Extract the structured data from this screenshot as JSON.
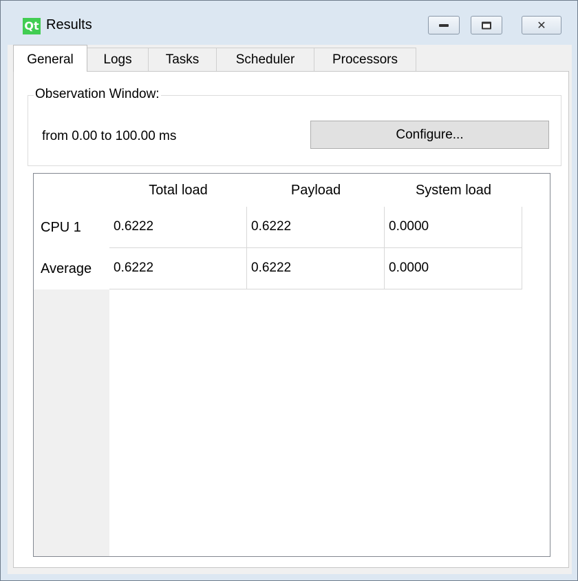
{
  "window": {
    "app_icon_text": "Qt",
    "title": "Results",
    "buttons": {
      "minimize": "minimize-icon",
      "maximize": "maximize-icon",
      "close": "close-icon",
      "close_glyph": "✕"
    }
  },
  "tabs": [
    {
      "label": "General",
      "active": true
    },
    {
      "label": "Logs",
      "active": false
    },
    {
      "label": "Tasks",
      "active": false
    },
    {
      "label": "Scheduler",
      "active": false
    },
    {
      "label": "Processors",
      "active": false
    }
  ],
  "observation": {
    "group_title": "Observation Window:",
    "range_text": "from 0.00 to 100.00 ms",
    "configure_label": "Configure..."
  },
  "table": {
    "columns": [
      "Total load",
      "Payload",
      "System load"
    ],
    "rows": [
      {
        "header": "CPU 1",
        "values": [
          "0.6222",
          "0.6222",
          "0.0000"
        ]
      },
      {
        "header": "Average",
        "values": [
          "0.6222",
          "0.6222",
          "0.0000"
        ]
      }
    ]
  },
  "colors": {
    "qt_brand": "#41cd52",
    "frame": "#dce7f2",
    "client_bg": "#f0f0f0"
  }
}
